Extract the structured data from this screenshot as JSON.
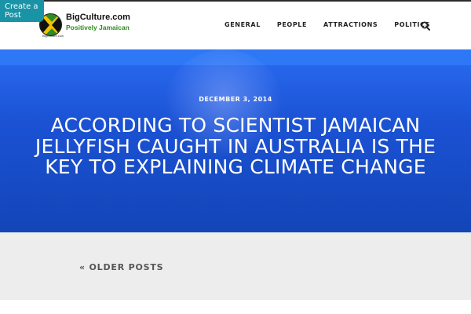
{
  "create_post": {
    "label": "Create a Post"
  },
  "logo": {
    "site_name": "BigCulture.com",
    "tagline": "Positively Jamaican",
    "small_text": "BigCulture.com"
  },
  "nav": {
    "items": [
      {
        "label": "GENERAL"
      },
      {
        "label": "PEOPLE"
      },
      {
        "label": "ATTRACTIONS"
      },
      {
        "label": "POLITICS"
      }
    ],
    "search_icon": "search-icon"
  },
  "hero": {
    "date": "DECEMBER 3, 2014",
    "title": "ACCORDING TO SCIENTIST JAMAICAN JELLYFISH CAUGHT IN AUSTRALIA IS THE KEY TO EXPLAINING CLIMATE CHANGE"
  },
  "pagination": {
    "older_label": "« OLDER POSTS"
  },
  "colors": {
    "accent_teal": "#1a93a6",
    "hero_blue": "#1b52d4",
    "footer_gray": "#ededed",
    "logo_green": "#2c8c1c"
  }
}
